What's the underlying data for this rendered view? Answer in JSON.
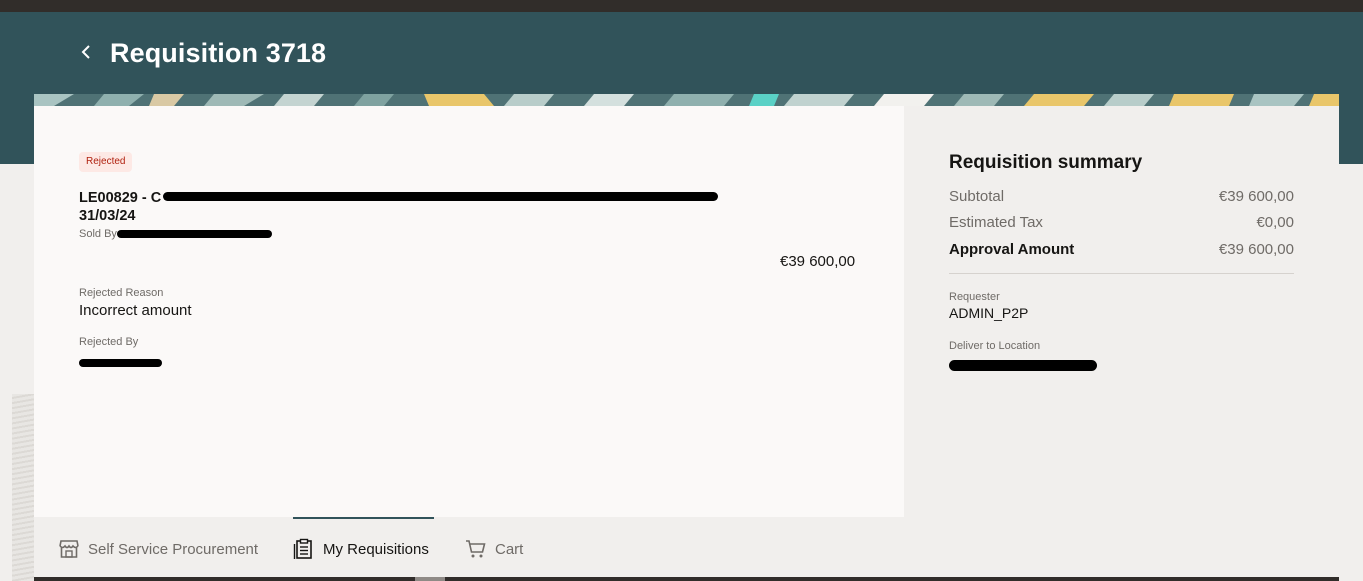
{
  "header": {
    "title": "Requisition 3718"
  },
  "item": {
    "status": "Rejected",
    "title_prefix": "LE00829 - C",
    "title_line2": "31/03/24",
    "sold_by_label": "Sold By",
    "price": "€39 600,00",
    "rejected_reason_label": "Rejected Reason",
    "rejected_reason": "Incorrect amount",
    "rejected_by_label": "Rejected By"
  },
  "summary": {
    "title": "Requisition summary",
    "subtotal_label": "Subtotal",
    "subtotal": "€39 600,00",
    "tax_label": "Estimated Tax",
    "tax": "€0,00",
    "approval_label": "Approval Amount",
    "approval": "€39 600,00",
    "requester_label": "Requester",
    "requester": "ADMIN_P2P",
    "deliver_label": "Deliver to Location"
  },
  "nav": {
    "self_service": "Self Service Procurement",
    "my_requisitions": "My Requisitions",
    "cart": "Cart"
  },
  "colors": {
    "header": "#31535a",
    "status_text": "#b0210f",
    "status_bg": "#fde9e5"
  },
  "icons": {
    "back": "chevron-left-icon",
    "store": "storefront-icon",
    "requisitions": "clipboard-icon",
    "cart": "cart-icon"
  }
}
